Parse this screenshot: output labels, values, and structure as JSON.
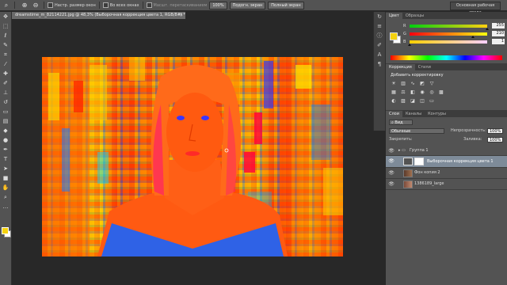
{
  "options_bar": {
    "resize_windows_label": "Настр. размер окон",
    "all_windows_label": "Во всех окнах",
    "scrubby_zoom_label": "Масшт. перетаскиванием",
    "zoom_value": "100%",
    "fit_screen_label": "Подогн. экран",
    "full_screen_label": "Полный экран",
    "workspace_label": "Основная рабочая среда"
  },
  "document": {
    "tab_title": "dreamstime_m_82114221.jpg @ 48,3% (Выборочная коррекция цвета 1, RGB/8#) *",
    "close": "×"
  },
  "color_panel": {
    "tabs": [
      "Цвет",
      "Образцы"
    ],
    "sliders": [
      {
        "name": "R",
        "value": "255",
        "fraction": 1.0,
        "gradient": "linear-gradient(90deg,#00d00f,#ffd00f)"
      },
      {
        "name": "G",
        "value": "210",
        "fraction": 0.82,
        "gradient": "linear-gradient(90deg,#ff000f,#ffff0f)"
      },
      {
        "name": "B",
        "value": "1",
        "fraction": 0.0,
        "gradient": "linear-gradient(90deg,#ffd000,#ffd0ff)"
      }
    ],
    "fg_color": "#f5d20f",
    "bg_color": "#ffffff"
  },
  "adjustments_panel": {
    "tabs": [
      "Коррекция",
      "Стили"
    ],
    "title": "Добавить корректировку"
  },
  "layers_panel": {
    "tabs": [
      "Слои",
      "Каналы",
      "Контуры"
    ],
    "filter_kind": "Вид",
    "blend_mode": "Обычные",
    "opacity_label": "Непрозрачность:",
    "opacity_value": "100%",
    "lock_label": "Закрепить:",
    "fill_label": "Заливка:",
    "fill_value": "100%",
    "layers": [
      {
        "name": "Группа 1",
        "type": "group"
      },
      {
        "name": "Выборочная коррекция цвета 1",
        "type": "adjustment",
        "selected": true
      },
      {
        "name": "Фон копия 2",
        "type": "pixel"
      },
      {
        "name": "1386189_large",
        "type": "pixel"
      }
    ]
  }
}
